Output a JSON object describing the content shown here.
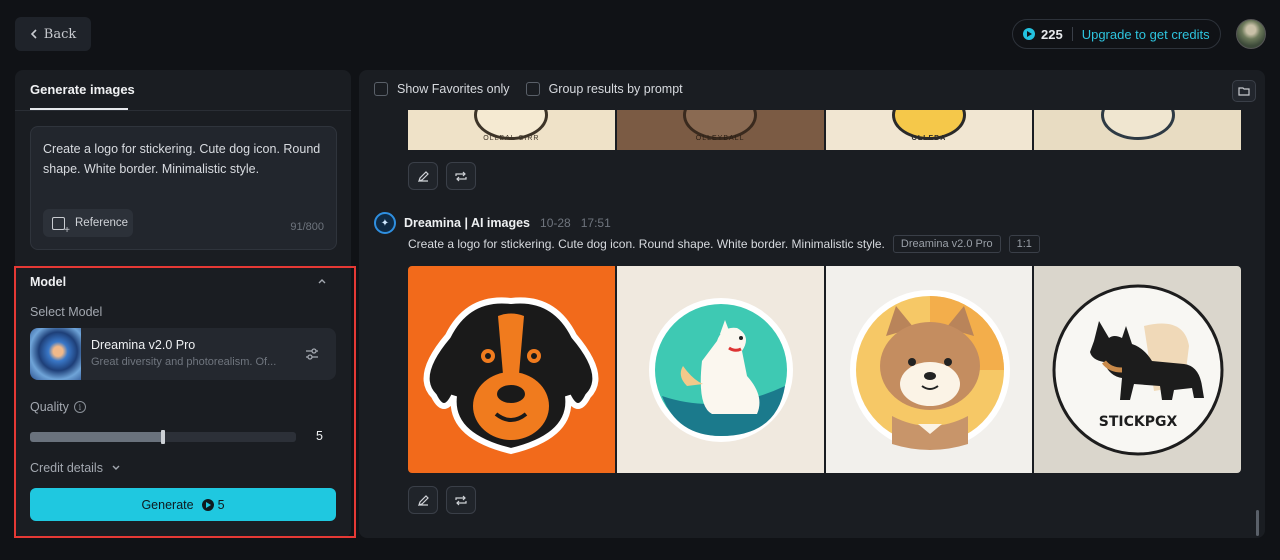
{
  "topbar": {
    "back_label": "Back",
    "credits_count": "225",
    "upgrade_label": "Upgrade to get credits"
  },
  "left_panel": {
    "tab_label": "Generate images",
    "prompt_text": "Create a logo for stickering. Cute dog icon. Round shape. White border. Minimalistic style.",
    "reference_label": "Reference",
    "char_count": "91/800",
    "model": {
      "section_title": "Model",
      "select_label": "Select Model",
      "model_name": "Dreamina v2.0 Pro",
      "model_description": "Great diversity and photorealism. Of...",
      "quality_label": "Quality",
      "quality_value": "5",
      "quality_fraction": 0.5,
      "credit_details_label": "Credit details",
      "generate_label": "Generate",
      "generate_cost": "5"
    }
  },
  "right_panel": {
    "filters": [
      {
        "label": "Show Favorites only",
        "checked": false
      },
      {
        "label": "Group results by prompt",
        "checked": false
      }
    ],
    "previous_strip_text": [
      "OLLBAL CIRR",
      "OLLEYBALL",
      "OLLEBA",
      ""
    ],
    "generation": {
      "source": "Dreamina | AI images",
      "date": "10-28",
      "time": "17:51",
      "prompt": "Create a logo for stickering. Cute dog icon. Round shape. White border. Minimalistic style.",
      "tags": [
        "Dreamina v2.0 Pro",
        "1:1"
      ],
      "images": [
        {
          "subject": "black and orange dog face sticker on orange background"
        },
        {
          "subject": "white dog sitting in teal circle sticker"
        },
        {
          "subject": "shiba inu face in orange circle sticker"
        },
        {
          "subject": "dog silhouette circle sticker",
          "caption": "STICKPGX"
        }
      ]
    }
  },
  "colors": {
    "accent": "#1fc8e0",
    "highlight": "#e53935",
    "background": "#101216",
    "panel": "#1a1d22"
  }
}
